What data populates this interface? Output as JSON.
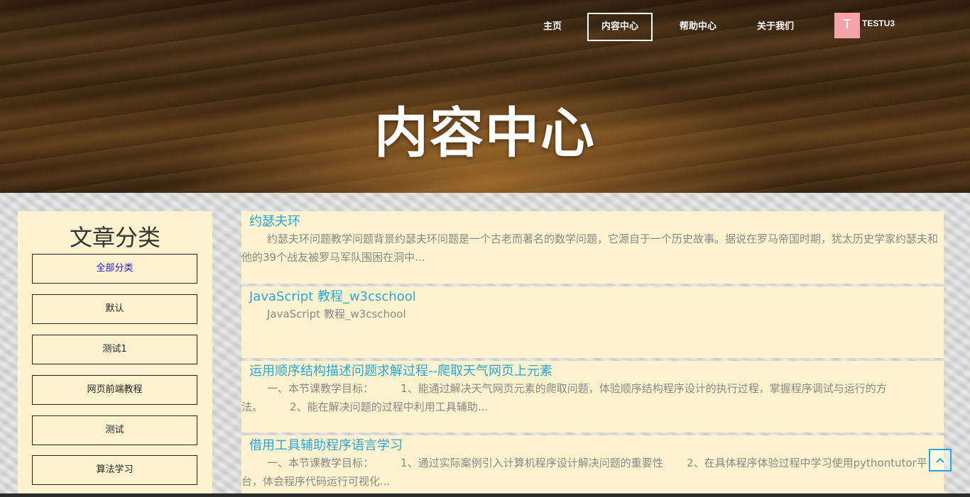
{
  "nav": {
    "home": "主页",
    "content_center": "内容中心",
    "help_center": "帮助中心",
    "about_us": "关于我们"
  },
  "user": {
    "avatar_letter": "T",
    "avatar_color": "#f4a4a8",
    "name": "TESTU3"
  },
  "hero": {
    "title": "内容中心"
  },
  "sidebar": {
    "title": "文章分类",
    "categories": [
      {
        "label": "全部分类",
        "active": true
      },
      {
        "label": "默认"
      },
      {
        "label": "测试1"
      },
      {
        "label": "网页前端教程"
      },
      {
        "label": "测试"
      },
      {
        "label": "算法学习"
      }
    ]
  },
  "articles": [
    {
      "title": "约瑟夫环",
      "summary": "约瑟夫环问题教学问题背景约瑟夫环问题是一个古老而著名的数学问题，它源自于一个历史故事。据说在罗马帝国时期，犹太历史学家约瑟夫和他的39个战友被罗马军队围困在洞中..."
    },
    {
      "title": "JavaScript 教程_w3cschool",
      "summary": "JavaScript 教程_w3cschool"
    },
    {
      "title": "运用顺序结构描述问题求解过程--爬取天气网页上元素",
      "summary": "一、本节课教学目标：        1、能通过解决天气网页元素的爬取问题，体验顺序结构程序设计的执行过程，掌握程序调试与运行的方法。        2、能在解决问题的过程中利用工具辅助..."
    },
    {
      "title": "借用工具辅助程序语言学习",
      "summary": "一、本节课教学目标：        1、通过实际案例引入计算机程序设计解决问题的重要性       2、在具体程序体验过程中学习使用pythontutor平台，体会程序代码运行可视化..."
    }
  ],
  "colors": {
    "panel_bg": "#fff3cf",
    "article_title": "#2aa6d9",
    "active_category": "#1a1ad6"
  },
  "icons": {
    "back_to_top": "chevron-up-icon"
  }
}
